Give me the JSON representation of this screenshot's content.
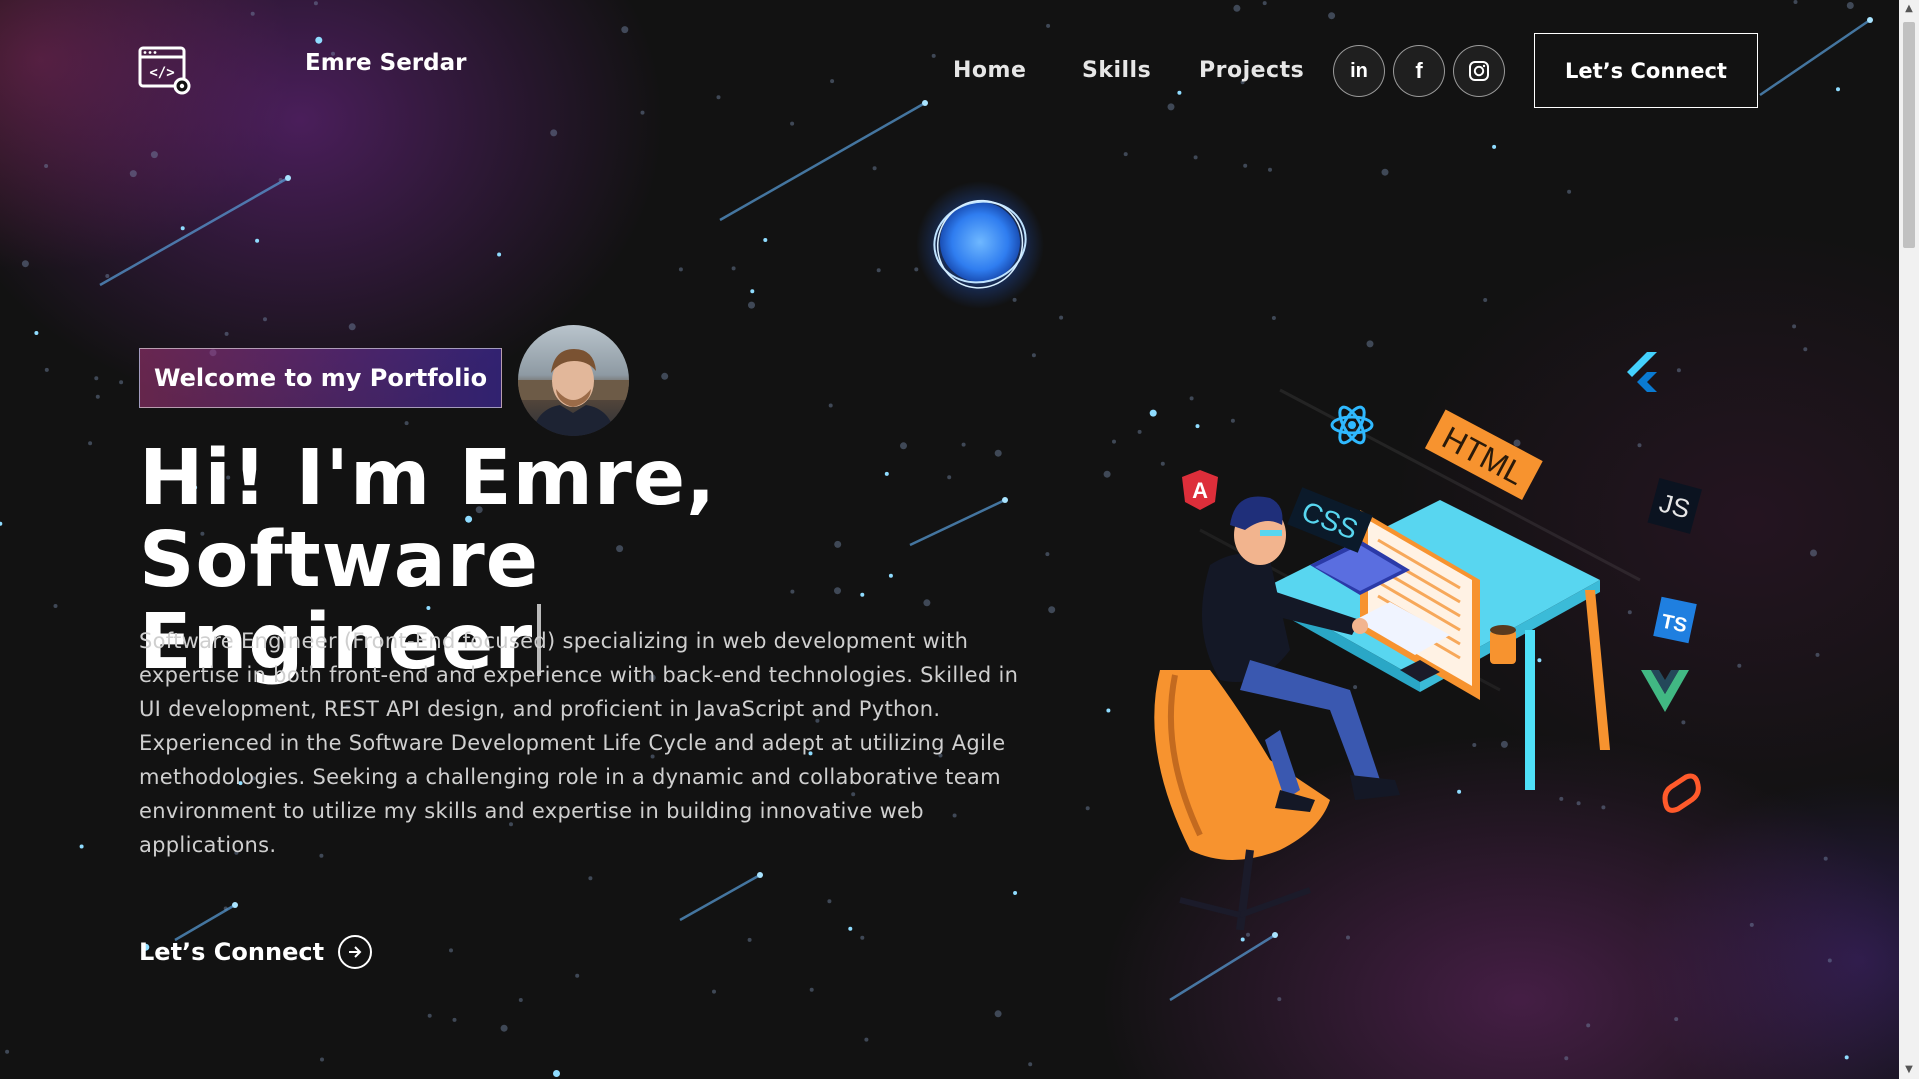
{
  "nav": {
    "logo_icon": "code-window-gear-icon",
    "brand": "Emre Serdar",
    "links": [
      {
        "label": "Home"
      },
      {
        "label": "Skills"
      },
      {
        "label": "Projects"
      }
    ],
    "social": [
      {
        "icon": "linkedin-icon",
        "label": "in"
      },
      {
        "icon": "facebook-icon",
        "label": "f"
      },
      {
        "icon": "instagram-icon"
      }
    ],
    "connect_button": "Let’s Connect"
  },
  "hero": {
    "tagline": "Welcome to my Portfolio",
    "headline_line1": "Hi! I'm Emre, Software",
    "headline_line2": "Engineer",
    "bio": "Software Engineer (Front-End focused) specializing in web development with expertise in both front-end and experience with back-end technologies. Skilled in UI development, REST API design, and proficient in JavaScript and Python. Experienced in the Software Development Life Cycle and adept at utilizing Agile methodologies. Seeking a challenging role in a dynamic and collaborative team environment to utilize my skills and expertise in building innovative web applications.",
    "cta": "Let’s Connect",
    "cta_icon": "arrow-right-circle-icon"
  },
  "illustration": {
    "labels": {
      "html": "HTML",
      "css": "CSS",
      "js": "JS",
      "ts": "TS"
    },
    "icons": [
      "react-icon",
      "angular-icon",
      "flutter-icon",
      "vue-icon",
      "svelte-icon"
    ]
  },
  "colors": {
    "background": "#121212",
    "tagline_gradient_start": "#aa367c",
    "tagline_gradient_end": "#4a2fbd",
    "planet": "#3b8cff",
    "desk": "#58d6f0",
    "chair": "#f7932f"
  }
}
